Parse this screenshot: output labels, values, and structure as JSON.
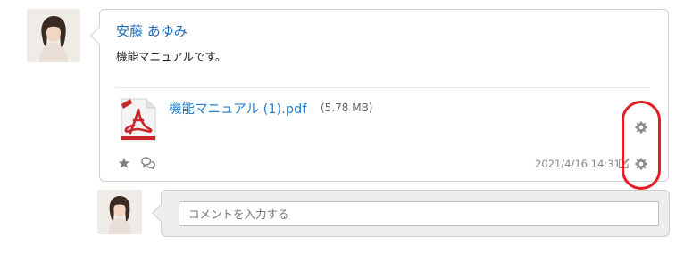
{
  "post": {
    "author": "安藤 あゆみ",
    "message": "機能マニュアルです。",
    "attachment": {
      "name": "機能マニュアル (1).pdf",
      "size": "(5.78 MB)",
      "icon": "pdf-file-icon"
    },
    "timestamp": "2021/4/16 14:31"
  },
  "comment": {
    "placeholder": "コメントを入力する"
  },
  "icons": {
    "star": "star-icon",
    "comment": "comment-bubbles-icon",
    "edit": "pencil-icon",
    "settings": "gear-icon"
  },
  "colors": {
    "author": "#1f6bb6",
    "link": "#1f7fd1",
    "highlight": "#e41d24",
    "pdf": "#c8262b"
  }
}
